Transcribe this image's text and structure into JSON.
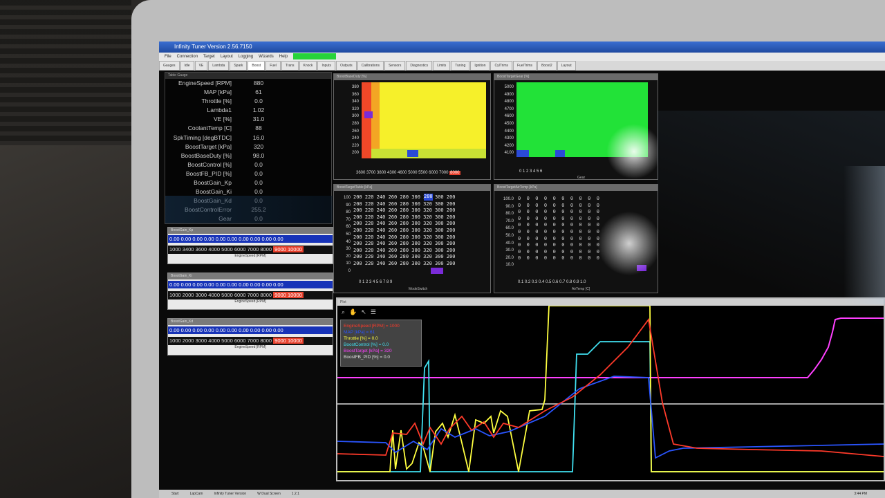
{
  "window": {
    "title": "Infinity Tuner Version 2.56.7150",
    "menu": [
      "File",
      "Connection",
      "Target",
      "Layout",
      "Logging",
      "Wizards",
      "Help"
    ],
    "tabs": [
      "Gauges",
      "Idle",
      "VE",
      "Lambda",
      "Spark",
      "Boost",
      "Fuel",
      "Trans",
      "Knock",
      "Inputs",
      "Outputs",
      "Calibrations",
      "Sensors",
      "Diagnostics",
      "Limits",
      "Tuning",
      "Ignition",
      "CylTrims",
      "FuelTrims",
      "Boost2",
      "Layout"
    ]
  },
  "gauges": {
    "header": "Table Gauge",
    "rows": [
      {
        "label": "EngineSpeed [RPM]",
        "value": "880"
      },
      {
        "label": "MAP [kPa]",
        "value": "61"
      },
      {
        "label": "Throttle [%]",
        "value": "0.0"
      },
      {
        "label": "Lambda1",
        "value": "1.02"
      },
      {
        "label": "VE [%]",
        "value": "31.0"
      },
      {
        "label": "CoolantTemp [C]",
        "value": "88"
      },
      {
        "label": "SpkTiming [degBTDC]",
        "value": "16.0"
      },
      {
        "label": "BoostTarget [kPa]",
        "value": "320"
      },
      {
        "label": "BoostBaseDuty [%]",
        "value": "98.0"
      },
      {
        "label": "BoostControl [%]",
        "value": "0.0"
      },
      {
        "label": "BoostFB_PID [%]",
        "value": "0.0"
      },
      {
        "label": "BoostGain_Kp",
        "value": "0.0"
      },
      {
        "label": "BoostGain_Ki",
        "value": "0.0"
      },
      {
        "label": "BoostGain_Kd",
        "value": "0.0"
      },
      {
        "label": "BoostControlError",
        "value": "255.2"
      },
      {
        "label": "Gear",
        "value": "0.0"
      }
    ]
  },
  "tables1d": [
    {
      "header": "BoostGain_Kp",
      "values": "0.00  0.00  0.00  0.00  0.00  0.00  0.00  0.00  0.00  0.00",
      "axis": "1000  3400  3600  4000  5000  6000  7000  8000",
      "axis_hi": "9000  10000",
      "axis_label": "EngineSpeed [RPM]"
    },
    {
      "header": "BoostGain_Ki",
      "values": "0.00  0.00  0.00  0.00  0.00  0.00  0.00  0.00  0.00  0.00",
      "axis": "1000  2000  3000  4000  5000  6000  7000  8000",
      "axis_hi": "9000  10000",
      "axis_label": "EngineSpeed [RPM]"
    },
    {
      "header": "BoostGain_Kd",
      "values": "0.00  0.00  0.00  0.00  0.00  0.00  0.00  0.00  0.00  0.00",
      "axis": "1000  2000  3000  4000  5000  6000  7000  8000",
      "axis_hi": "9000  10000",
      "axis_label": "EngineSpeed [RPM]"
    }
  ],
  "map_boostbase": {
    "header": "BoostBaseDuty [%]",
    "y_axis": [
      "380",
      "360",
      "340",
      "320",
      "300",
      "280",
      "260",
      "240",
      "220",
      "200"
    ],
    "x_axis": "3600  3700  3800  4300  4600  5000  5500  6000  7000",
    "x_hi": "8000",
    "x_label": "EngineSpeed [RPM]"
  },
  "map_gear": {
    "header": "BoostTargetGear [%]",
    "y_axis": [
      "5000",
      "4900",
      "4800",
      "4700",
      "4600",
      "4500",
      "4400",
      "4300",
      "4200",
      "4100"
    ],
    "x_axis": "0     1     2     3     4     5     6",
    "x_label": "Gear"
  },
  "map_target": {
    "header": "BoostTargetTable [kPa]",
    "y_axis": [
      "100",
      "90",
      "80",
      "70",
      "60",
      "50",
      "40",
      "30",
      "20",
      "10",
      "0"
    ],
    "rows": [
      "200 220 240 260 280 300 320 300 200",
      "200 220 240 260 280 300 320 300 200",
      "200 220 240 260 280 300 320 300 200",
      "200 220 240 260 280 300 320 300 200",
      "200 220 240 260 280 300 320 300 200",
      "200 220 240 260 280 300 320 300 200",
      "200 220 240 260 280 300 320 300 200",
      "200 220 240 260 280 300 320 300 200",
      "200 220 240 260 280 300 320 300 200",
      "200 220 240 260 280 300 320 300 200",
      "200 220 240 260 280 300 320 300 200"
    ],
    "highlight": "280",
    "x_axis": "0   1   2   3   4   5   6   7   8   9",
    "x_label": "ModeSwitch"
  },
  "map_airtemp": {
    "header": "BoostTargetAirTemp [kPa]",
    "y_axis": [
      "100.0",
      "90.0",
      "80.0",
      "70.0",
      "60.0",
      "50.0",
      "40.0",
      "30.0",
      "20.0",
      "10.0"
    ],
    "rows": [
      "0  0  0  0  0  0  0  0  0  0",
      "0  0  0  0  0  0  0  0  0  0",
      "0  0  0  0  0  0  0  0  0  0",
      "0  0  0  0  0  0  0  0  0  0",
      "0  0  0  0  0  0  0  0  0  0",
      "0  0  0  0  0  0  0  0  0  0",
      "0  0  0  0  0  0  0  0  0  0",
      "0  0  0  0  0  0  0  0  0  0",
      "0  0  0  0  0  0  0  0  0  0",
      "0  0  0  0  0  0  0  0  0  0"
    ],
    "x_axis": "0.1  0.2  0.3  0.4  0.5  0.6  0.7  0.8  0.9  1.0",
    "x_label": "AirTemp [C]"
  },
  "plot": {
    "header": "Plot",
    "legend": [
      {
        "text": "EngineSpeed [RPM] = 1000",
        "color": "#ff3a2a"
      },
      {
        "text": "MAP [kPa] = 61",
        "color": "#2a55ff"
      },
      {
        "text": "Throttle [%] = 0.0",
        "color": "#ffff40"
      },
      {
        "text": "BoostControl [%] = 0.0",
        "color": "#40e0f0"
      },
      {
        "text": "BoostTarget [kPa] = 320",
        "color": "#ff40ff"
      },
      {
        "text": "BoostFB_PID [%] = 0.0",
        "color": "#e0e0e0"
      }
    ]
  },
  "taskbar": {
    "items": [
      "Start",
      "LapCam",
      "Infinity Tuner Version",
      "W Dual Screen",
      "1.2.1"
    ],
    "clock": "3:44 PM"
  }
}
